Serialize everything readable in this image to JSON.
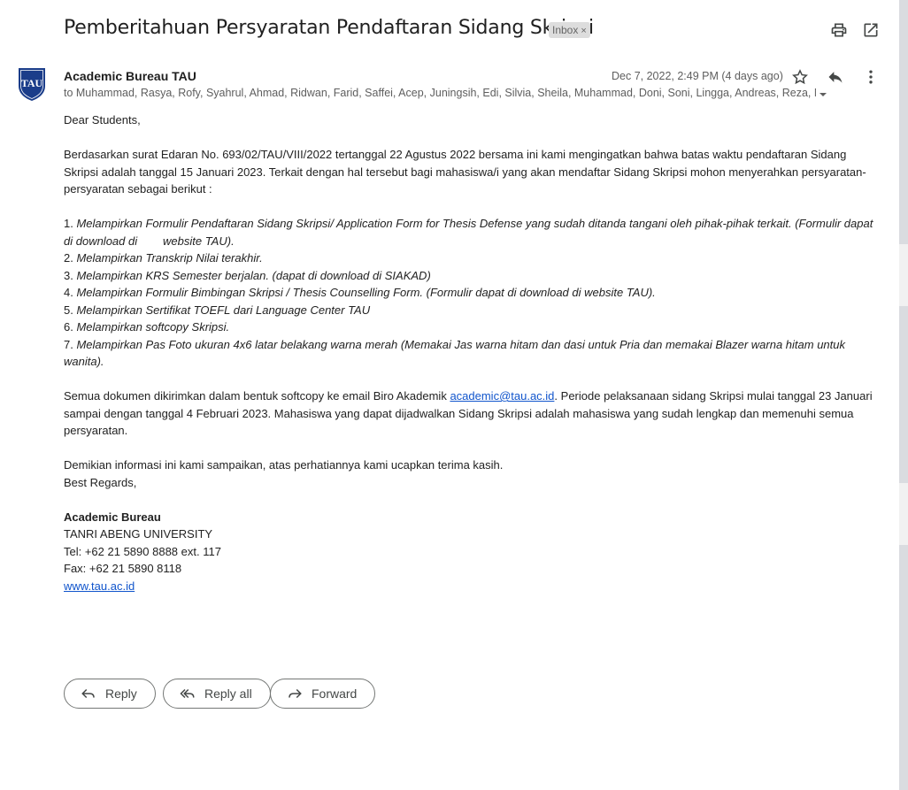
{
  "email": {
    "subject": "Pemberitahuan Persyaratan Pendaftaran Sidang Skripsi",
    "label": "Inbox",
    "label_remove": "×",
    "sender": "Academic Bureau TAU",
    "date": "Dec 7, 2022, 2:49 PM (4 days ago)",
    "recipients": "to Muhammad, Rasya, Rofy, Syahrul, Ahmad, Ridwan, Farid, Saffei, Acep, Juningsih, Edi, Silvia, Sheila, Muhammad, Doni, Soni, Lingga, Andreas, Reza, Muham",
    "avatar_text": "TAU",
    "body": {
      "greeting": "Dear Students,",
      "intro": "Berdasarkan surat Edaran No. 693/02/TAU/VIII/2022 tertanggal 22 Agustus 2022 bersama ini kami mengingatkan bahwa batas waktu pendaftaran Sidang Skripsi adalah tanggal 15 Januari 2023. Terkait dengan hal tersebut bagi mahasiswa/i yang akan mendaftar Sidang Skripsi mohon menyerahkan persyaratan-persyaratan sebagai berikut :",
      "requirements": [
        {
          "num": "1. ",
          "text": "Melampirkan Formulir Pendaftaran Sidang Skripsi/ Application Form for Thesis Defense yang sudah ditanda tangani oleh pihak-pihak terkait. (Formulir dapat di download di        website TAU)."
        },
        {
          "num": "2. ",
          "text": "Melampirkan Transkrip Nilai terakhir."
        },
        {
          "num": "3. ",
          "text": "Melampirkan KRS Semester berjalan. (dapat di download di SIAKAD)"
        },
        {
          "num": "4. ",
          "text": "Melampirkan Formulir Bimbingan Skripsi / Thesis Counselling Form. (Formulir dapat di download di website TAU)."
        },
        {
          "num": "5. ",
          "text": "Melampirkan Sertifikat TOEFL dari Language Center TAU"
        },
        {
          "num": "6. ",
          "text": "Melampirkan softcopy Skripsi."
        },
        {
          "num": "7. ",
          "text": "Melampirkan Pas Foto ukuran 4x6 latar belakang warna merah (Memakai Jas warna hitam dan dasi untuk Pria dan memakai Blazer warna hitam untuk wanita)."
        }
      ],
      "docs_pre": "Semua dokumen dikirimkan dalam bentuk softcopy ke email Biro Akademik ",
      "docs_email": "academic@tau.ac.id",
      "docs_post": ". Periode pelaksanaan sidang Skripsi mulai tanggal 23 Januari sampai dengan tanggal 4 Februari 2023. Mahasiswa yang dapat dijadwalkan Sidang Skripsi adalah mahasiswa yang sudah lengkap dan memenuhi semua persyaratan.",
      "closing": "Demikian informasi ini kami sampaikan, atas perhatiannya kami ucapkan terima kasih.",
      "regards": "Best Regards,"
    },
    "signature": {
      "name": "Academic Bureau",
      "org": "TANRI ABENG UNIVERSITY",
      "tel": "Tel: +62 21 5890 8888 ext. 117",
      "fax": "Fax: +62 21 5890 8118",
      "web": "www.tau.ac.id"
    }
  },
  "actions": {
    "reply": "Reply",
    "reply_all": "Reply all",
    "forward": "Forward"
  },
  "icons": {
    "print": "print-icon",
    "open_new_window": "open-in-new-icon",
    "star": "star-icon",
    "reply": "reply-icon",
    "more": "more-vert-icon",
    "recipients_expand": "caret-down-icon"
  },
  "colors": {
    "link": "#1155cc",
    "avatar_bg": "#1b3d8a",
    "label_chip": "#dddddd"
  }
}
